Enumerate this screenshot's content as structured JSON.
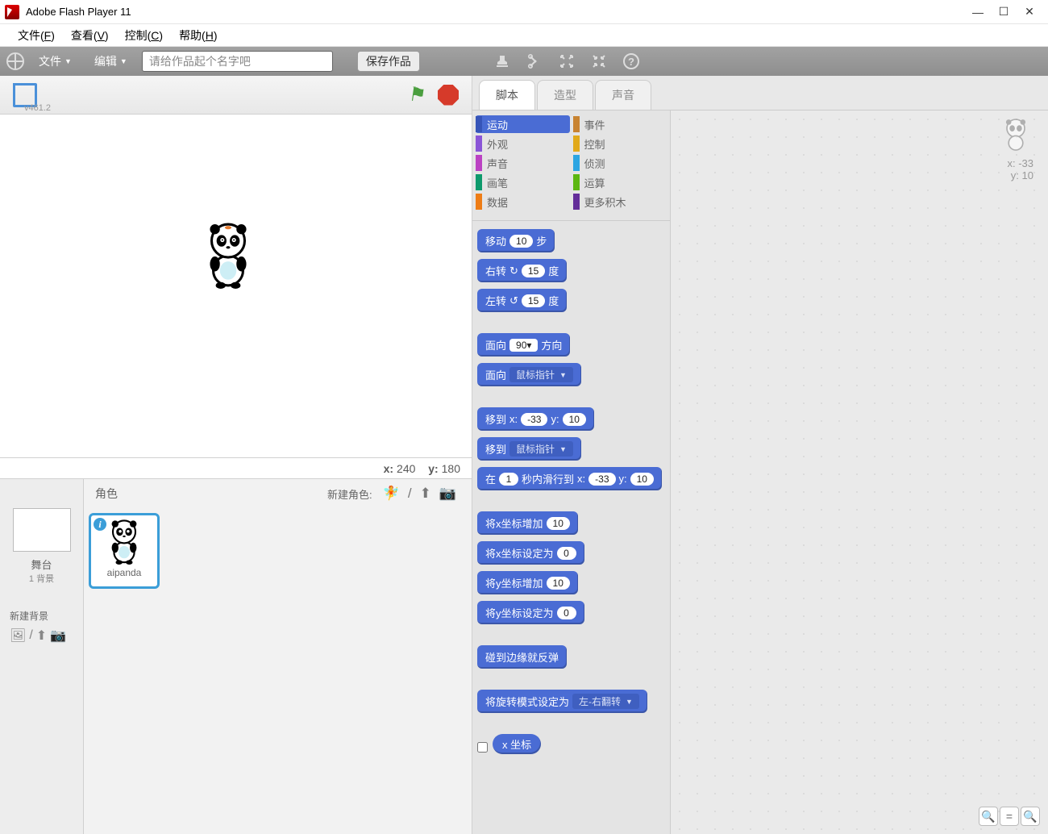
{
  "window": {
    "title": "Adobe Flash Player 11"
  },
  "app_menu": {
    "file": "文件(F)",
    "view": "查看(V)",
    "control": "控制(C)",
    "help": "帮助(H)"
  },
  "app_menu_u": {
    "file_l": "文件(",
    "file_k": "F",
    "view_l": "查看(",
    "view_k": "V",
    "ctrl_l": "控制(",
    "ctrl_k": "C",
    "help_l": "帮助(",
    "help_k": "H",
    "close": ")"
  },
  "toolbar": {
    "file": "文件",
    "edit": "编辑",
    "project_placeholder": "请给作品起个名字吧",
    "save": "保存作品"
  },
  "stage": {
    "version": "v461.2",
    "coord_x_label": "x:",
    "coord_x": "240",
    "coord_y_label": "y:",
    "coord_y": "180"
  },
  "stage_col": {
    "label": "舞台",
    "count": "1 背景",
    "newbg": "新建背景"
  },
  "sprites": {
    "title": "角色",
    "new_label": "新建角色:",
    "card_name": "aipanda"
  },
  "tabs": {
    "scripts": "脚本",
    "costumes": "造型",
    "sounds": "声音"
  },
  "cats": {
    "motion": "运动",
    "looks": "外观",
    "sound": "声音",
    "pen": "画笔",
    "data": "数据",
    "events": "事件",
    "control": "控制",
    "sensing": "侦测",
    "operators": "运算",
    "more": "更多积木"
  },
  "cat_colors": {
    "motion": "#4a6cd4",
    "looks": "#8a55d7",
    "sound": "#bb42c3",
    "pen": "#0e9a6c",
    "data": "#ee7d16",
    "events": "#c88330",
    "control": "#e1a91a",
    "sensing": "#2ca5e2",
    "operators": "#5cb712",
    "more": "#632d99"
  },
  "blocks": {
    "move_a": "移动",
    "move_b": "步",
    "move_v": "10",
    "turnr_a": "右转",
    "turnr_b": "度",
    "turnr_v": "15",
    "turnl_a": "左转",
    "turnl_b": "度",
    "turnl_v": "15",
    "point_a": "面向",
    "point_b": "方向",
    "point_v": "90",
    "point2_a": "面向",
    "point2_dd": "鼠标指针",
    "goto_a": "移到",
    "goto_xl": "x:",
    "goto_xv": "-33",
    "goto_yl": "y:",
    "goto_yv": "10",
    "goto2_a": "移到",
    "goto2_dd": "鼠标指针",
    "glide_a": "在",
    "glide_sec": "1",
    "glide_b": "秒内滑行到",
    "glide_xl": "x:",
    "glide_xv": "-33",
    "glide_yl": "y:",
    "glide_yv": "10",
    "chx_a": "将x坐标增加",
    "chx_v": "10",
    "setx_a": "将x坐标设定为",
    "setx_v": "0",
    "chy_a": "将y坐标增加",
    "chy_v": "10",
    "sety_a": "将y坐标设定为",
    "sety_v": "0",
    "bounce": "碰到边缘就反弹",
    "rot_a": "将旋转模式设定为",
    "rot_dd": "左-右翻转",
    "xpos": "x 坐标"
  },
  "script_info": {
    "x_label": "x:",
    "x": "-33",
    "y_label": "y:",
    "y": "10"
  }
}
